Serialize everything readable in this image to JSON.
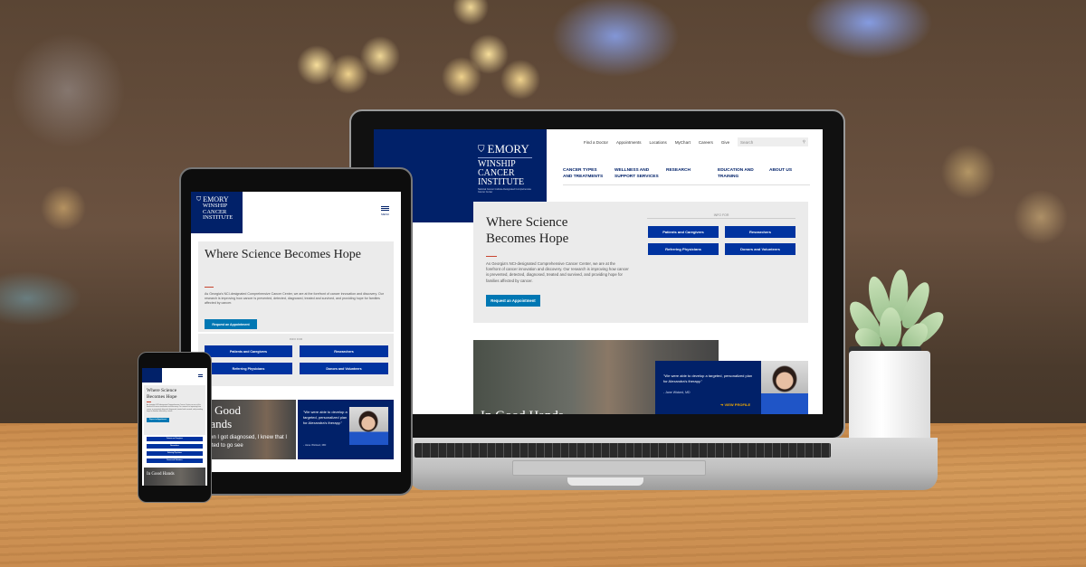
{
  "brand": {
    "org": "EMORY",
    "name_line1": "WINSHIP",
    "name_line2": "CANCER",
    "name_line3": "INSTITUTE",
    "tagline": "National Cancer Institute-Designated Comprehensive Cancer Center"
  },
  "utility_nav": [
    "Find a Doctor",
    "Appointments",
    "Locations",
    "MyChart",
    "Careers",
    "Give"
  ],
  "search": {
    "placeholder": "Search"
  },
  "main_nav": [
    {
      "line1": "CANCER TYPES",
      "line2": "AND TREATMENTS"
    },
    {
      "line1": "WELLNESS AND",
      "line2": "SUPPORT SERVICES"
    },
    {
      "line1": "RESEARCH",
      "line2": ""
    },
    {
      "line1": "EDUCATION AND",
      "line2": "TRAINING"
    },
    {
      "line1": "ABOUT US",
      "line2": ""
    }
  ],
  "hero": {
    "title": "Where Science Becomes Hope",
    "title_l1": "Where Science",
    "title_l2": "Becomes Hope",
    "body": "As Georgia's NCI-designated Comprehensive Cancer Center, we are at the forefront of cancer innovation and discovery. Our research is improving how cancer is prevented, detected, diagnosed, treated and survived, and providing hope for families affected by cancer.",
    "cta": "Request an Appointment",
    "for_label": "INFO FOR",
    "audiences": [
      "Patients and Caregivers",
      "Researchers",
      "Referring Physicians",
      "Donors and Volunteers"
    ]
  },
  "feature": {
    "title": "In Good Hands",
    "title_l1": "In Good",
    "title_l2": "Hands",
    "subtext": "When I got diagnosed, I knew that I wanted to go see",
    "quote": "\"We were able to develop a targeted, personalized plan for Alexandra's therapy.\"",
    "attribution": "- Jane Wicked, MD",
    "profile_link": "VIEW PROFILE"
  },
  "tablet": {
    "menu_label": "MENU"
  },
  "colors": {
    "navy": "#012169",
    "button_blue": "#0033a0",
    "cta_blue": "#0077b3",
    "accent_red": "#c8442f",
    "link_gold": "#f2a900"
  }
}
